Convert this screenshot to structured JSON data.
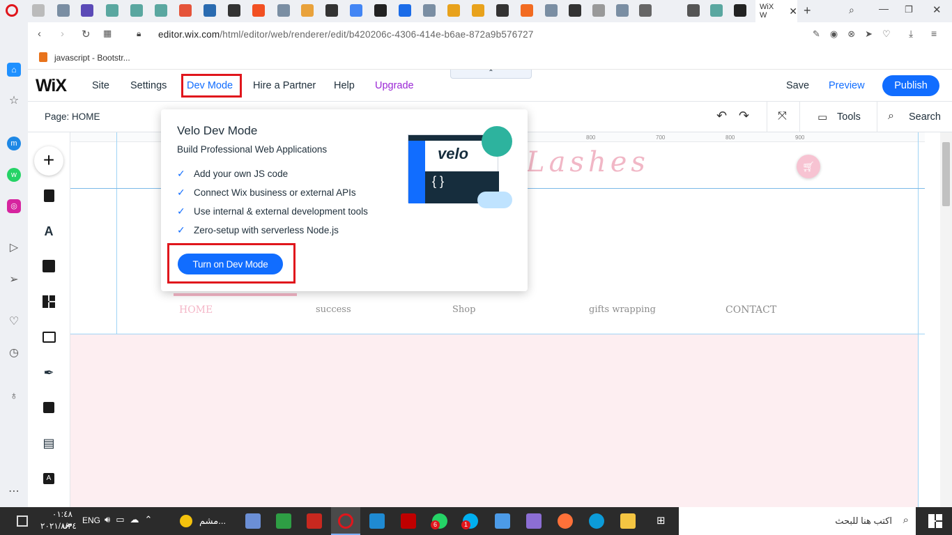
{
  "browser": {
    "active_tab_title": "WiX W",
    "url_domain": "editor.wix.com",
    "url_path": "/html/editor/web/renderer/edit/b420206c-4306-414e-b6ae-872a9b576727",
    "bookmark": "javascript - Bootstr..."
  },
  "wix": {
    "logo": "WiX",
    "menu": [
      "Site",
      "Settings",
      "Dev Mode",
      "Hire a Partner",
      "Help",
      "Upgrade"
    ],
    "save": "Save",
    "preview": "Preview",
    "publish": "Publish",
    "page_label": "Page: HOME",
    "tools": "Tools",
    "search": "Search"
  },
  "popover": {
    "title": "Velo Dev Mode",
    "subtitle": "Build Professional Web Applications",
    "features": [
      "Add your own JS code",
      "Connect Wix business or external APIs",
      "Use internal & external development tools",
      "Zero-setup with serverless Node.js"
    ],
    "button": "Turn on Dev Mode",
    "illustration_text": "velo"
  },
  "site": {
    "logo_text": "Lashes",
    "nav": [
      "HOME",
      "success",
      "Shop",
      "gifts wrapping",
      "CONTACT"
    ],
    "ruler_ticks": [
      "800",
      "700",
      "800",
      "900"
    ]
  },
  "taskbar": {
    "time": "٠١:٤٨ ص",
    "date": "٢٠٢١/٨/٢٤",
    "lang": "ENG",
    "search_text": "اكتب هنا للبحث",
    "weather": "مشم...",
    "badges": [
      "6",
      "1"
    ]
  },
  "colors": {
    "accent": "#116dff",
    "upgrade": "#9a27d5",
    "highlight": "#e0161c",
    "pink": "#fdeef1"
  }
}
